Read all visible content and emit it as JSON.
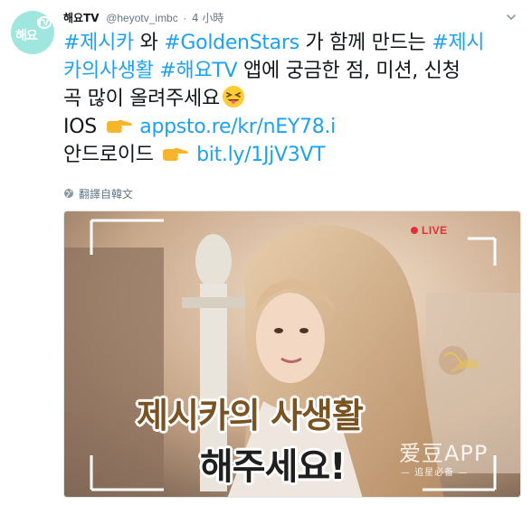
{
  "tweet": {
    "avatar": {
      "text": "해요",
      "badge": "TV",
      "color": "#9fe6df"
    },
    "author": {
      "name": "해요TV",
      "handle": "@heyotv_imbc",
      "separator": "·",
      "time": "4 小時"
    },
    "body": {
      "line1": [
        {
          "text": "#제시카",
          "link": true
        },
        {
          "text": " 와 ",
          "link": false
        },
        {
          "text": "#GoldenStars",
          "link": true
        },
        {
          "text": " 가 함께 만드는 ",
          "link": false
        },
        {
          "text": "#제시",
          "link": true
        }
      ],
      "line2": [
        {
          "text": "카의사생활",
          "link": true
        },
        {
          "text": " ",
          "link": false
        },
        {
          "text": "#해요TV",
          "link": true
        },
        {
          "text": " 앱에 궁금한 점, 미션, 신청",
          "link": false
        }
      ],
      "line3": {
        "text": "곡 많이 올려주세요",
        "emoji": "squinting-face-tongue-emoji"
      },
      "line4": {
        "label": "IOS",
        "emoji": "pointing-right-emoji",
        "url": "appsto.re/kr/nEY78.i"
      },
      "line5": {
        "label": "안드로이드",
        "emoji": "pointing-right-emoji",
        "url": "bit.ly/1JjV3VT"
      }
    },
    "translate": {
      "label": "翻譯自韓文",
      "icon": "globe-icon"
    },
    "media": {
      "live_label": "LIVE",
      "title_line1": "제시카의 사생활",
      "title_line2": "해주세요!",
      "watermark_main": "爱豆APP",
      "watermark_sub": "— 追星必备 —"
    },
    "colors": {
      "link": "#1da1f2",
      "meta": "#657786",
      "live": "#e0303a",
      "title_brown": "#7a5322"
    }
  }
}
